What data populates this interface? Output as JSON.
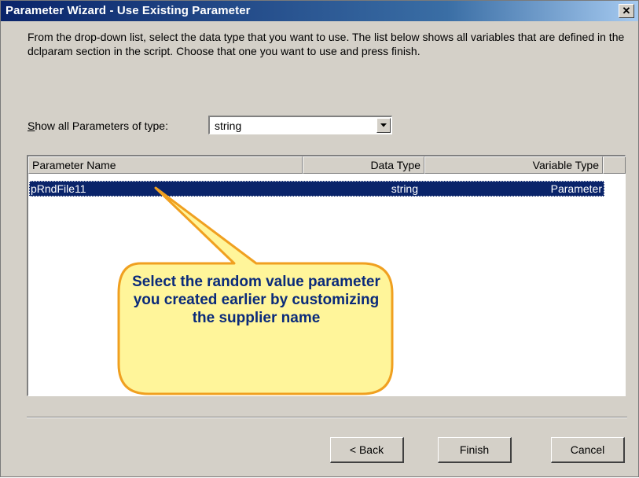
{
  "window": {
    "title": "Parameter Wizard - Use Existing Parameter",
    "close_glyph": "✕"
  },
  "description": "From the drop-down list, select the data type that you want to use. The list below shows all variables that are defined in the dclparam section in the script. Choose that one you want to use and press finish.",
  "filter": {
    "label": "Show all Parameters of type:",
    "selected": "string"
  },
  "list": {
    "columns": [
      "Parameter Name",
      "Data Type",
      "Variable Type"
    ],
    "rows": [
      {
        "name": "pRndFile11",
        "data_type": "string",
        "variable_type": "Parameter",
        "selected": true
      }
    ]
  },
  "callout": {
    "text": "Select the random value parameter you created earlier by customizing the supplier name",
    "color": "#fff59a"
  },
  "buttons": {
    "back": "< Back",
    "finish": "Finish",
    "cancel": "Cancel"
  }
}
